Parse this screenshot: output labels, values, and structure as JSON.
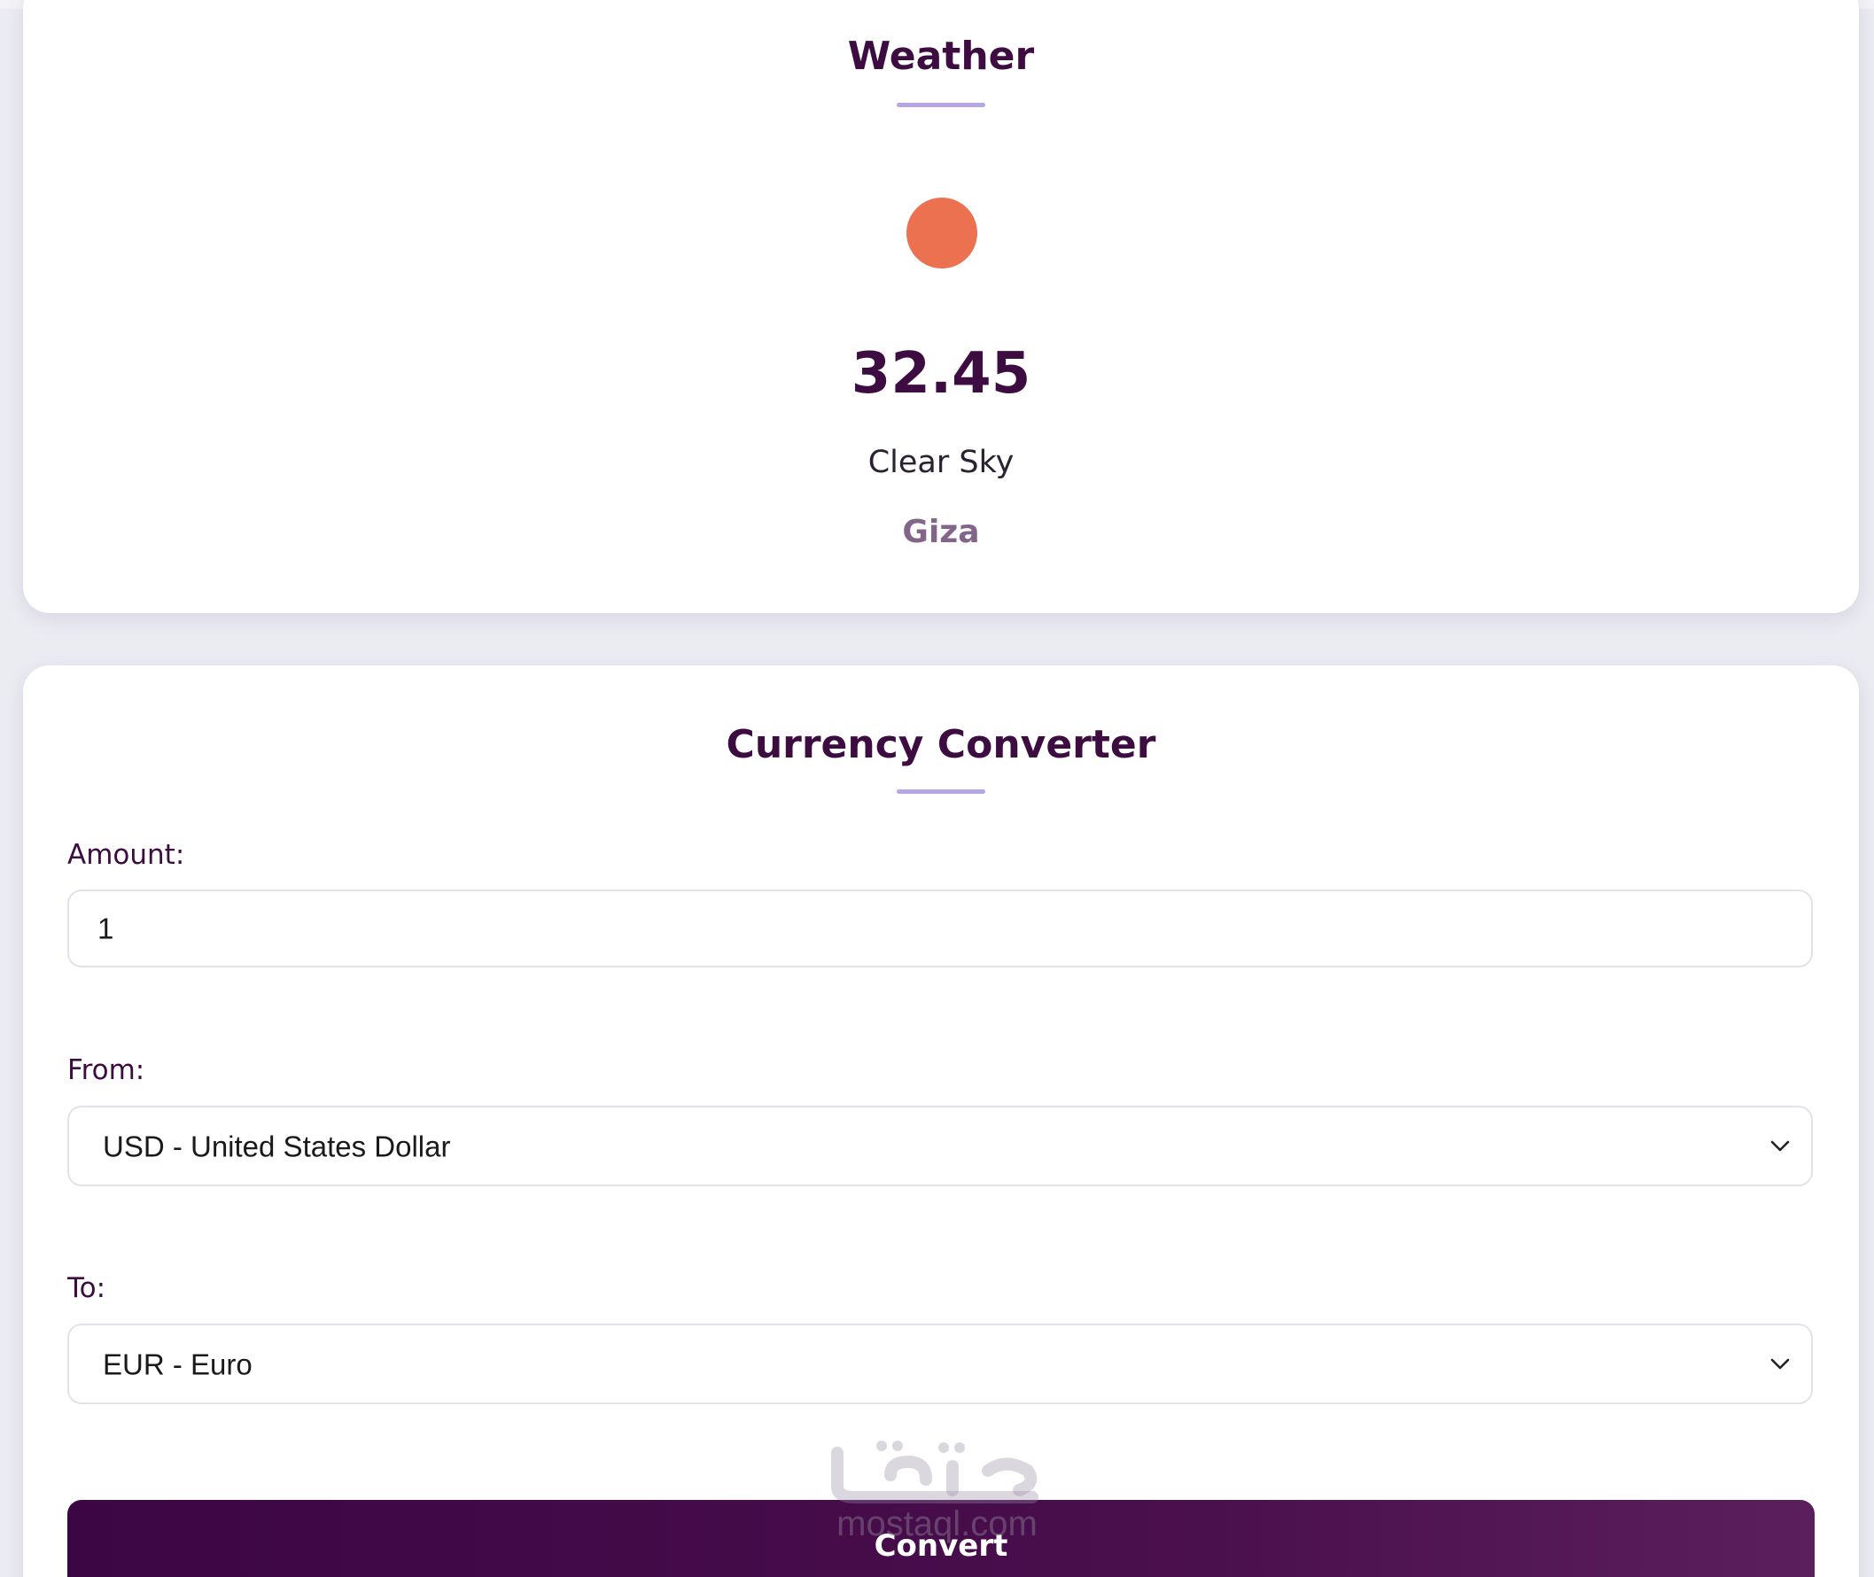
{
  "weather": {
    "title": "Weather",
    "icon": "sun-icon",
    "temperature": "32.45",
    "description": "Clear Sky",
    "city": "Giza"
  },
  "currency": {
    "title": "Currency Converter",
    "amount_label": "Amount:",
    "amount_value": "1",
    "from_label": "From:",
    "from_value": "USD - United States Dollar",
    "to_label": "To:",
    "to_value": "EUR - Euro",
    "convert_label": "Convert"
  },
  "watermark": {
    "text": "mostaql.com"
  },
  "colors": {
    "primary": "#3d0d42",
    "accent": "#b5a6e6",
    "sun": "#ec7150",
    "city": "#83658a",
    "background": "#ebebf2"
  }
}
